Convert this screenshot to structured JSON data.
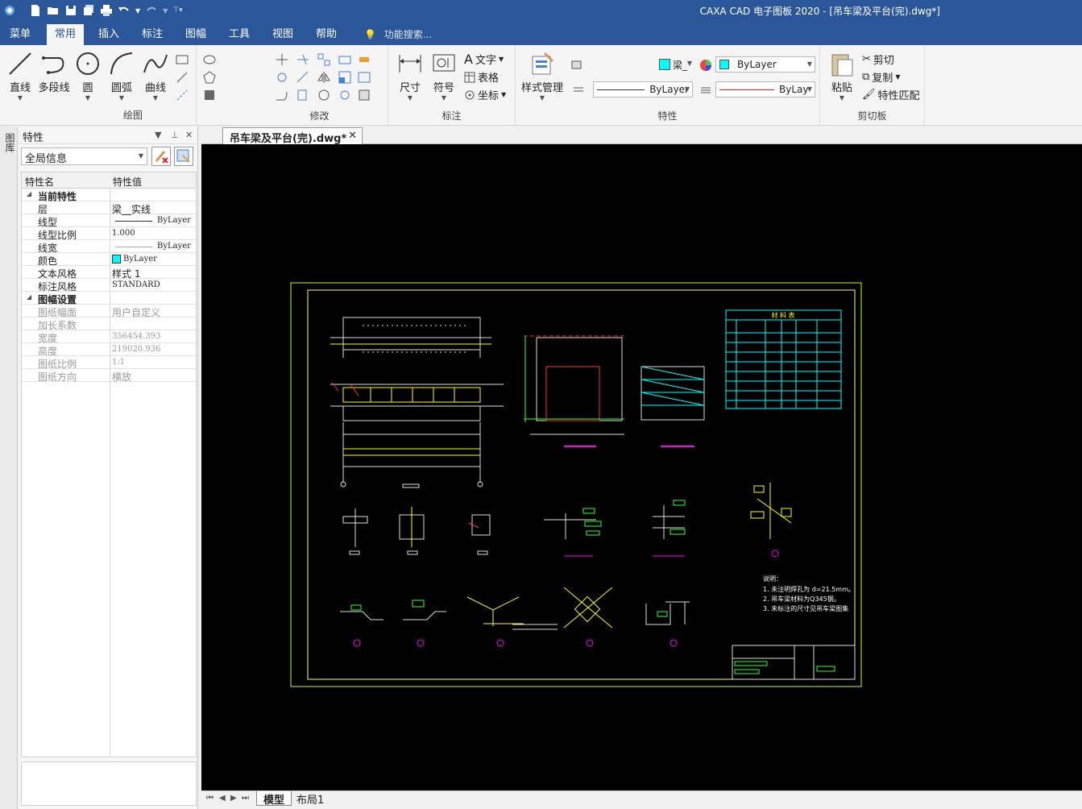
{
  "app": {
    "title": "CAXA CAD 电子图板 2020 - [吊车梁及平台(完).dwg*]"
  },
  "ribbon": {
    "tabs": [
      "菜单",
      "常用",
      "插入",
      "标注",
      "图幅",
      "工具",
      "视图",
      "帮助"
    ],
    "active_tab": "常用",
    "search_placeholder": "功能搜索...",
    "groups": {
      "draw": {
        "label": "绘图",
        "buttons": [
          "直线",
          "多段线",
          "圆",
          "圆弧",
          "曲线"
        ]
      },
      "modify": {
        "label": "修改"
      },
      "annotate": {
        "label": "标注",
        "buttons": [
          "尺寸",
          "符号"
        ],
        "small": [
          "文字",
          "表格",
          "坐标"
        ]
      },
      "style": {
        "label": "样式管理"
      },
      "properties": {
        "label": "特性",
        "layer": "梁_",
        "color": "ByLayer",
        "linetype": "ByLayer",
        "lineweight": "ByLay"
      },
      "clipboard": {
        "label": "剪切板",
        "paste": "粘贴",
        "items": [
          "剪切",
          "复制",
          "特性匹配"
        ]
      }
    }
  },
  "side_strip": {
    "label": "图库"
  },
  "properties_panel": {
    "title": "特性",
    "filter": "全局信息",
    "col_name": "特性名",
    "col_value": "特性值",
    "current_section": "当前特性",
    "current": [
      {
        "name": "层",
        "value": "梁__实线"
      },
      {
        "name": "线型",
        "value": "ByLayer"
      },
      {
        "name": "线型比例",
        "value": "1.000"
      },
      {
        "name": "线宽",
        "value": "ByLayer"
      },
      {
        "name": "颜色",
        "value": "ByLayer"
      },
      {
        "name": "文本风格",
        "value": "样式 1"
      },
      {
        "name": "标注风格",
        "value": "STANDARD"
      }
    ],
    "sheet_section": "图幅设置",
    "sheet": [
      {
        "name": "图纸幅面",
        "value": "用户自定义"
      },
      {
        "name": "加长系数",
        "value": ""
      },
      {
        "name": "宽度",
        "value": "356454.393"
      },
      {
        "name": "高度",
        "value": "219020.936"
      },
      {
        "name": "图纸比例",
        "value": "1:1"
      },
      {
        "name": "图纸方向",
        "value": "横放"
      }
    ]
  },
  "document": {
    "tab": "吊车梁及平台(完).dwg*",
    "layout_tabs": [
      "模型",
      "布局1"
    ],
    "notes": [
      "说明：",
      "1. 未注明焊孔为 d=21.5mm。",
      "2. 吊车梁材料为Q345钢。",
      "3. 未标注的尺寸见吊车梁图集"
    ],
    "table_title": "材 料 表"
  },
  "colors": {
    "titlebar": "#2b579a",
    "canvas": "#000000",
    "frame": "#c8ff00",
    "cyan": "#00ffff",
    "yellow": "#ffff00",
    "magenta": "#ff00ff"
  }
}
